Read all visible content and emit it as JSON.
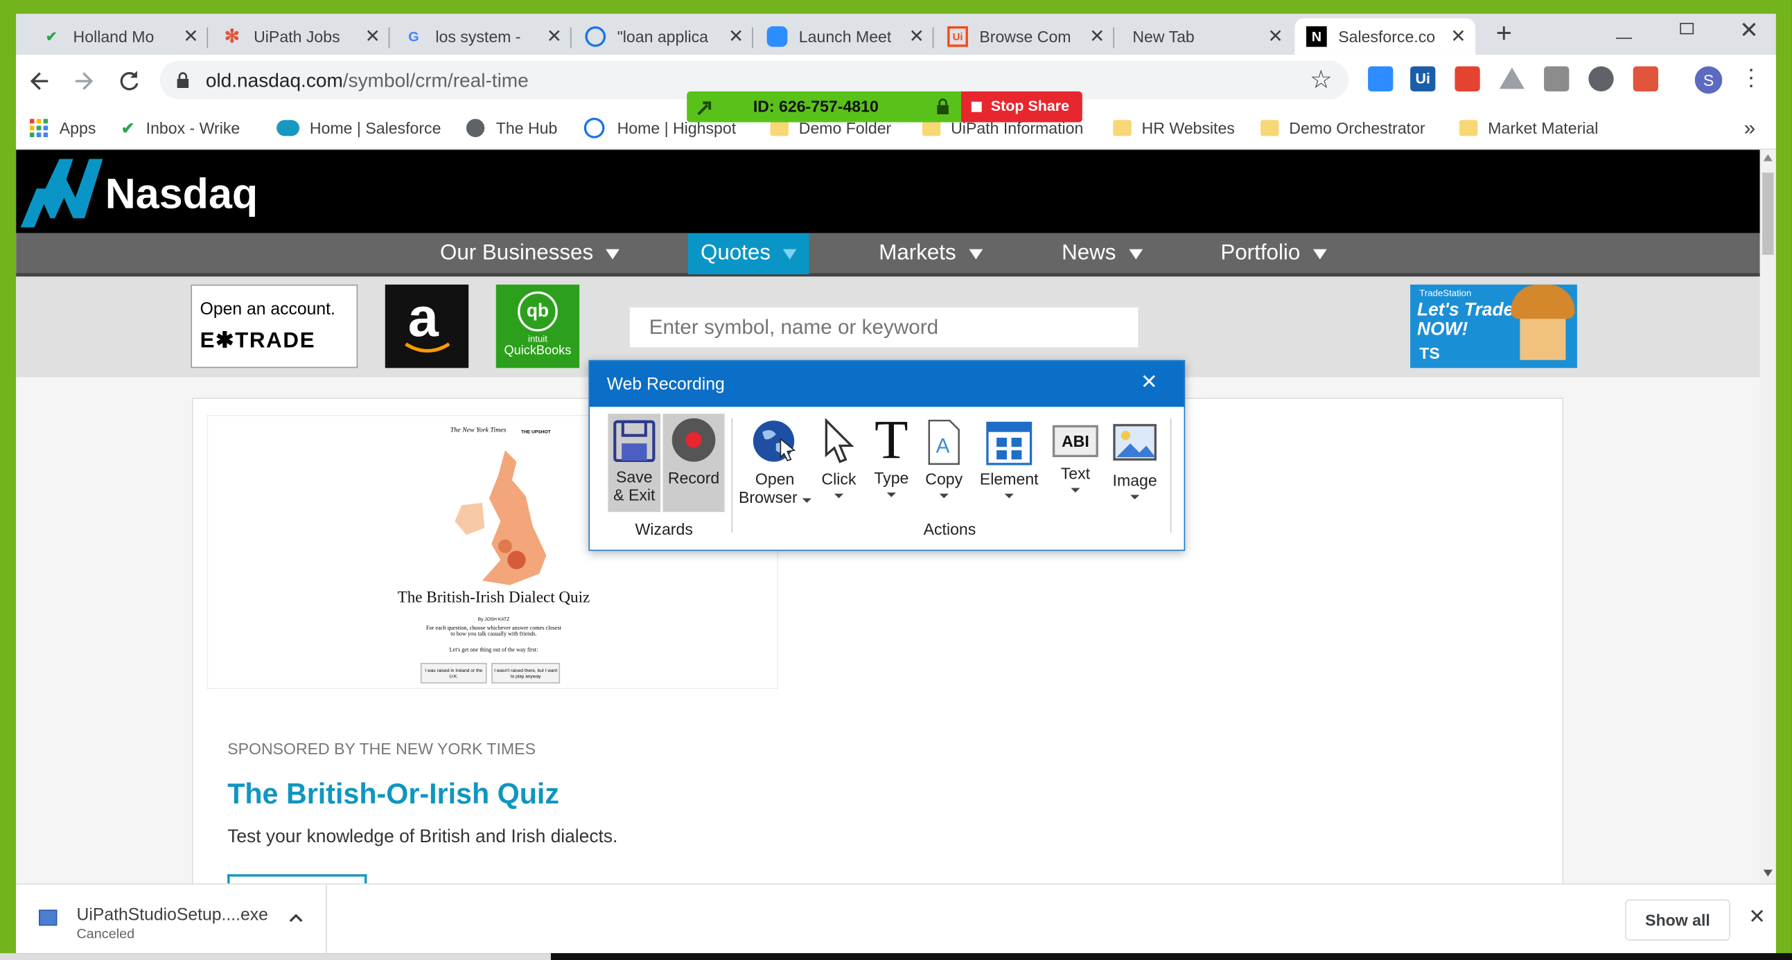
{
  "browser": {
    "tabs": [
      {
        "title": "Holland Mo",
        "icon": "wrike-check-icon",
        "color": "#2da44e"
      },
      {
        "title": "UiPath Jobs",
        "icon": "snowflake-icon",
        "color": "#e0553c"
      },
      {
        "title": "los system -",
        "icon": "google-icon",
        "color": "#4285f4"
      },
      {
        "title": "\"loan applica",
        "icon": "highspot-icon",
        "color": "#1a73e8"
      },
      {
        "title": "Launch Meet",
        "icon": "zoom-icon",
        "color": "#2d8cff"
      },
      {
        "title": "Browse Com",
        "icon": "uipath-icon",
        "color": "#fa4616"
      },
      {
        "title": "New Tab",
        "icon": "",
        "color": ""
      },
      {
        "title": "Salesforce.co",
        "icon": "nasdaq-icon",
        "color": "#000000"
      }
    ],
    "address": {
      "host": "old.nasdaq.com",
      "path": "/symbol/crm/real-time"
    },
    "profile_initial": "S",
    "bookmarks": [
      "Apps",
      "Inbox - Wrike",
      "Home | Salesforce",
      "The Hub",
      "Home | Highspot",
      "Demo Folder",
      "UiPath Information",
      "HR Websites",
      "Demo Orchestrator",
      "Market Material"
    ],
    "bookmarks_more": "»"
  },
  "share_bar": {
    "id_text": "ID: 626-757-4810",
    "stop_label": "Stop Share"
  },
  "nasdaq": {
    "logo_text": "Nasdaq",
    "nav": [
      {
        "label": "Our Businesses",
        "active": false
      },
      {
        "label": "Quotes",
        "active": true
      },
      {
        "label": "Markets",
        "active": false
      },
      {
        "label": "News",
        "active": false
      },
      {
        "label": "Portfolio",
        "active": false
      }
    ],
    "ads": {
      "etrade_top": "Open an account.",
      "etrade_brand": "E✱TRADE",
      "amazon": "a",
      "qb_logo": "qb",
      "qb_small": "intuit",
      "qb_name": "QuickBooks",
      "ts_small": "TradeStation",
      "ts_big1": "Let's Trade",
      "ts_big2": "NOW!",
      "ts_badge": "TS"
    },
    "search_placeholder": "Enter symbol, name or keyword",
    "card": {
      "thumb_paper": "The New York Times",
      "thumb_section": "THE UPSHOT",
      "thumb_title": "The British-Irish Dialect Quiz",
      "thumb_byline": "By JOSH KATZ",
      "thumb_desc": "For each question, choose whichever answer comes closest to how you talk casually with friends.",
      "thumb_q": "Let's get one thing out of the way first:",
      "thumb_opt1": "I was raised in Ireland or the U.K.",
      "thumb_opt2": "I wasn't raised there, but I want to play anyway",
      "sponsor": "SPONSORED BY THE NEW YORK TIMES",
      "title": "The British-Or-Irish Quiz",
      "desc": "Test your knowledge of British and Irish dialects."
    }
  },
  "web_recording": {
    "title": "Web Recording",
    "wizards_label": "Wizards",
    "actions_label": "Actions",
    "save_exit": [
      "Save",
      "& Exit"
    ],
    "record": "Record",
    "open_browser": [
      "Open",
      "Browser"
    ],
    "click": "Click",
    "type": "Type",
    "copy": "Copy",
    "element": "Element",
    "text": "Text",
    "image": "Image",
    "text_icon_glyph": "ABI"
  },
  "downloads": {
    "filename": "UiPathStudioSetup....exe",
    "status": "Canceled",
    "show_all": "Show all"
  }
}
